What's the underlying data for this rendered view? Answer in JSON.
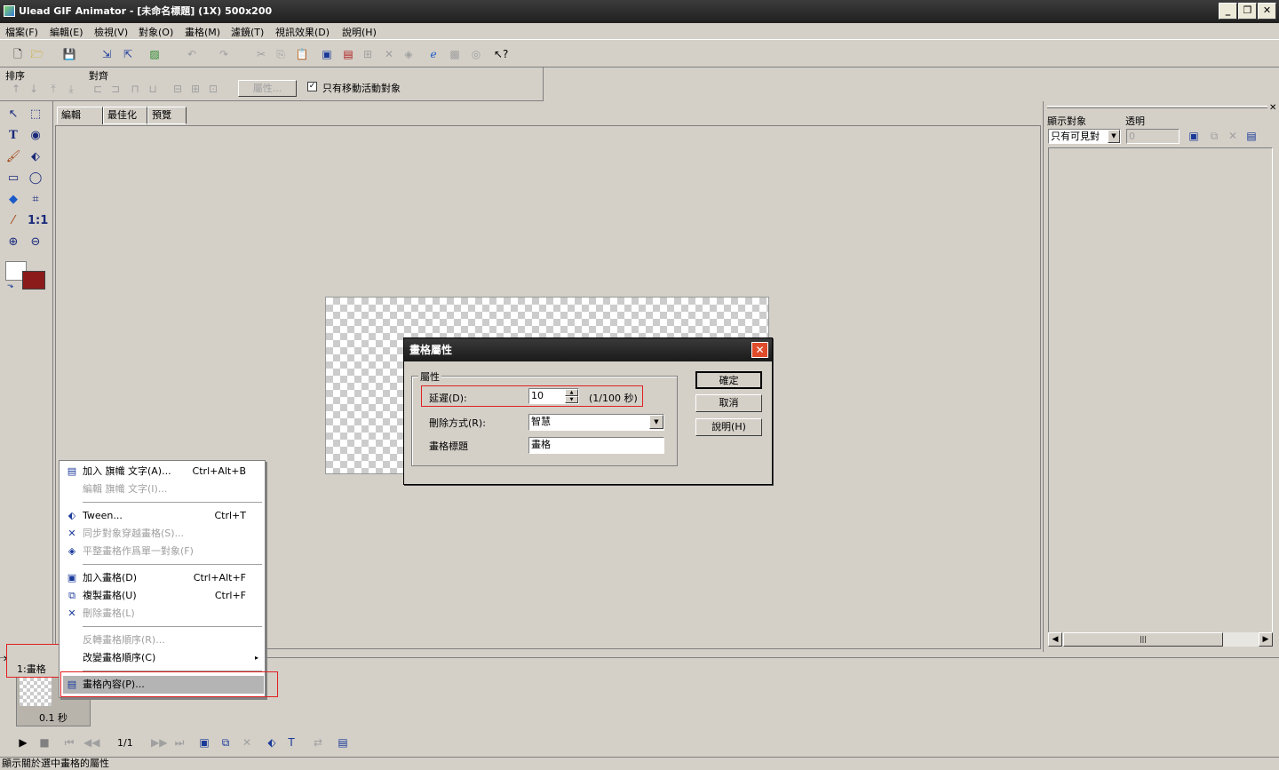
{
  "window": {
    "title": "Ulead GIF Animator - [未命名標題] (1X) 500x200",
    "min": "_",
    "max": "❐",
    "close": "✕"
  },
  "menu": [
    "檔案(F)",
    "編輯(E)",
    "檢視(V)",
    "對象(O)",
    "畫格(M)",
    "濾鏡(T)",
    "視訊效果(D)",
    "說明(H)"
  ],
  "toolbar2": {
    "order_label": "排序",
    "align_label": "對齊",
    "properties_btn": "屬性...",
    "move_active_only": "只有移動活動對象",
    "checked": true
  },
  "tabs": [
    "編輯",
    "最佳化",
    "預覽"
  ],
  "rightpanel": {
    "show_label": "顯示對象",
    "transparency_label": "透明",
    "show_value": "只有可見對",
    "transparency_value": "0"
  },
  "dialog": {
    "title": "畫格屬性",
    "group_label": "屬性",
    "delay_label": "延遲(D):",
    "delay_value": "10",
    "delay_unit": "(1/100 秒)",
    "removal_label": "刪除方式(R):",
    "removal_value": "智慧",
    "frame_title_label": "畫格標題",
    "frame_title_value": "畫格",
    "ok": "確定",
    "cancel": "取消",
    "help": "說明(H)"
  },
  "context_menu": [
    {
      "label": "加入 旗幟 文字(A)...",
      "shortcut": "Ctrl+Alt+B",
      "enabled": true,
      "icon": "banner-text-icon"
    },
    {
      "label": "編輯 旗幟 文字(I)...",
      "shortcut": "",
      "enabled": false,
      "icon": ""
    },
    {
      "label": "Tween...",
      "shortcut": "Ctrl+T",
      "enabled": true,
      "icon": "tween-icon"
    },
    {
      "label": "同步對象穿越畫格(S)...",
      "shortcut": "",
      "enabled": false,
      "icon": "sync-icon"
    },
    {
      "label": "平整畫格作爲單一對象(F)",
      "shortcut": "",
      "enabled": false,
      "icon": "flatten-icon"
    },
    {
      "label": "加入畫格(D)",
      "shortcut": "Ctrl+Alt+F",
      "enabled": true,
      "icon": "add-frame-icon"
    },
    {
      "label": "複製畫格(U)",
      "shortcut": "Ctrl+F",
      "enabled": true,
      "icon": "duplicate-frame-icon"
    },
    {
      "label": "刪除畫格(L)",
      "shortcut": "",
      "enabled": false,
      "icon": "delete-frame-icon"
    },
    {
      "label": "反轉畫格順序(R)...",
      "shortcut": "",
      "enabled": false,
      "icon": ""
    },
    {
      "label": "改變畫格順序(C)",
      "shortcut": "▸",
      "enabled": true,
      "icon": ""
    },
    {
      "label": "畫格內容(P)...",
      "shortcut": "",
      "enabled": true,
      "icon": "frame-properties-icon"
    }
  ],
  "frames": {
    "tab_label": "1:畫格",
    "duration": "0.1 秒",
    "counter": "1/1"
  },
  "status": "顯示關於選中畫格的屬性",
  "colors": {
    "background": "#d4d0c8",
    "highlight_red": "#e02020",
    "bg_swatch": "#8b1a1a"
  }
}
